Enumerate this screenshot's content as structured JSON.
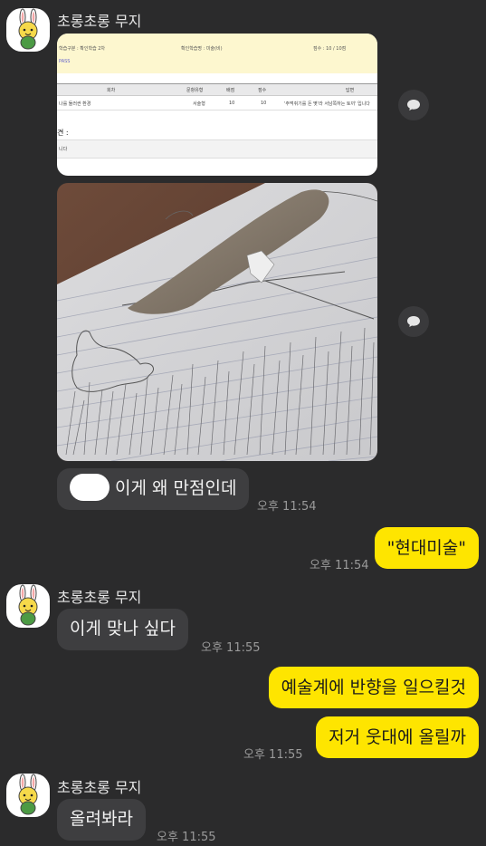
{
  "sender_name": "초롱초롱 무지",
  "doc": {
    "row1_col1": "학습구분 : 확인학습 2차",
    "row1_col2": "확인학습명 : 미술(비)",
    "row1_col3": "점수 : 10 / 10점",
    "pass": "PASS",
    "headers": [
      "회차",
      "문항유형",
      "배점",
      "점수",
      "답변"
    ],
    "row": [
      "나를 둘러싼 환경",
      "서술형",
      "10",
      "10",
      "'주먹쥐기를 돈 몇'라 서남쪽하는 토끼' 입니다"
    ],
    "opinion": "견 :",
    "note": "니다"
  },
  "messages": {
    "m1": "이게 왜 만점인데",
    "m1_time": "오후 11:54",
    "m2": "\"현대미술\"",
    "m2_time": "오후 11:54",
    "m3": "이게 맞나 싶다",
    "m3_time": "오후 11:55",
    "m4": "예술계에 반향을 일으킬것",
    "m5": "저거 웃대에 올릴까",
    "m5_time": "오후 11:55",
    "m6": "올려봐라",
    "m6_time": "오후 11:55"
  },
  "icons": {
    "share": "share-bubble-icon",
    "avatar": "muzi-rabbit-avatar"
  },
  "colors": {
    "background": "#2b2b2c",
    "incoming_bubble": "#3e3e40",
    "outgoing_bubble": "#fee500"
  }
}
